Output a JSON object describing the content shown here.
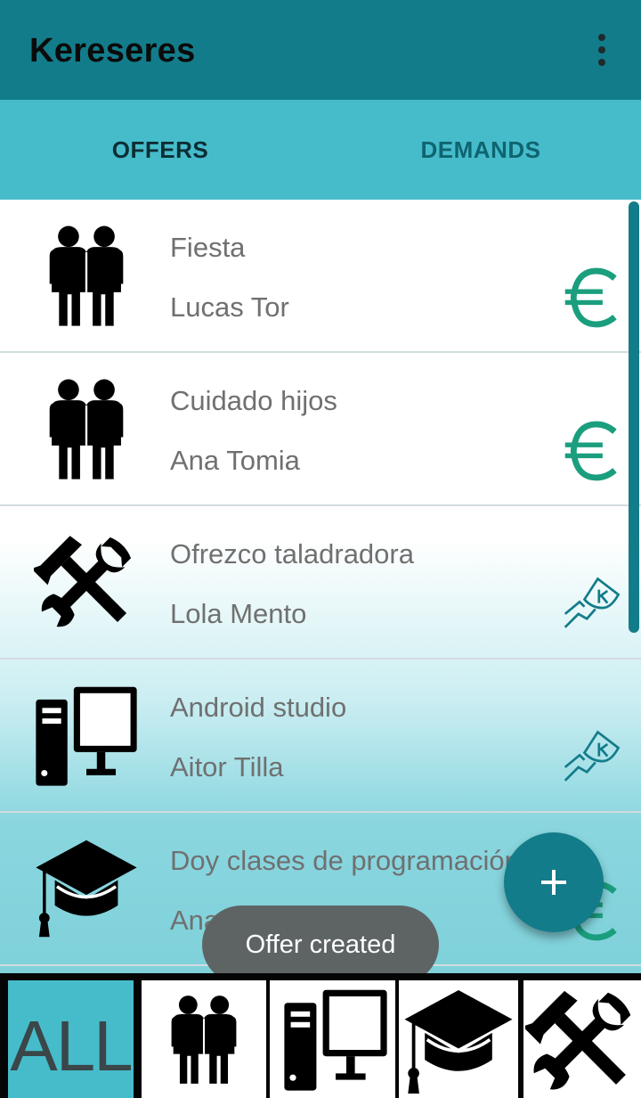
{
  "app": {
    "title": "Kereseres",
    "overflow_icon": "more-vert-icon"
  },
  "tabs": [
    {
      "label": "OFFERS",
      "selected": true
    },
    {
      "label": "DEMANDS",
      "selected": false
    }
  ],
  "offers": [
    {
      "title": "Fiesta",
      "user": "Lucas Tor",
      "category_icon": "people-icon",
      "payment_icon": "euro-icon"
    },
    {
      "title": "Cuidado hijos",
      "user": "Ana Tomia",
      "category_icon": "people-icon",
      "payment_icon": "euro-icon"
    },
    {
      "title": "Ofrezco taladradora",
      "user": "Lola Mento",
      "category_icon": "tools-icon",
      "payment_icon": "karma-icon"
    },
    {
      "title": "Android studio",
      "user": "Aitor Tilla",
      "category_icon": "computer-icon",
      "payment_icon": "karma-icon"
    },
    {
      "title": "Doy clases de programación",
      "user": "Ana Tomia",
      "category_icon": "graduation-cap-icon",
      "payment_icon": "euro-icon"
    }
  ],
  "fab": {
    "icon": "add-icon"
  },
  "toast": {
    "text": "Offer created"
  },
  "filters": [
    {
      "label": "ALL",
      "selected": true
    },
    {
      "icon": "people-icon"
    },
    {
      "icon": "computer-icon"
    },
    {
      "icon": "graduation-cap-icon"
    },
    {
      "icon": "tools-icon"
    }
  ],
  "colors": {
    "primary_dark": "#137c8a",
    "tab_background": "#46bccb",
    "tab_indicator": "#9c27b0",
    "euro_icon": "#1b9e7e",
    "karma_icon": "#137c8a"
  }
}
